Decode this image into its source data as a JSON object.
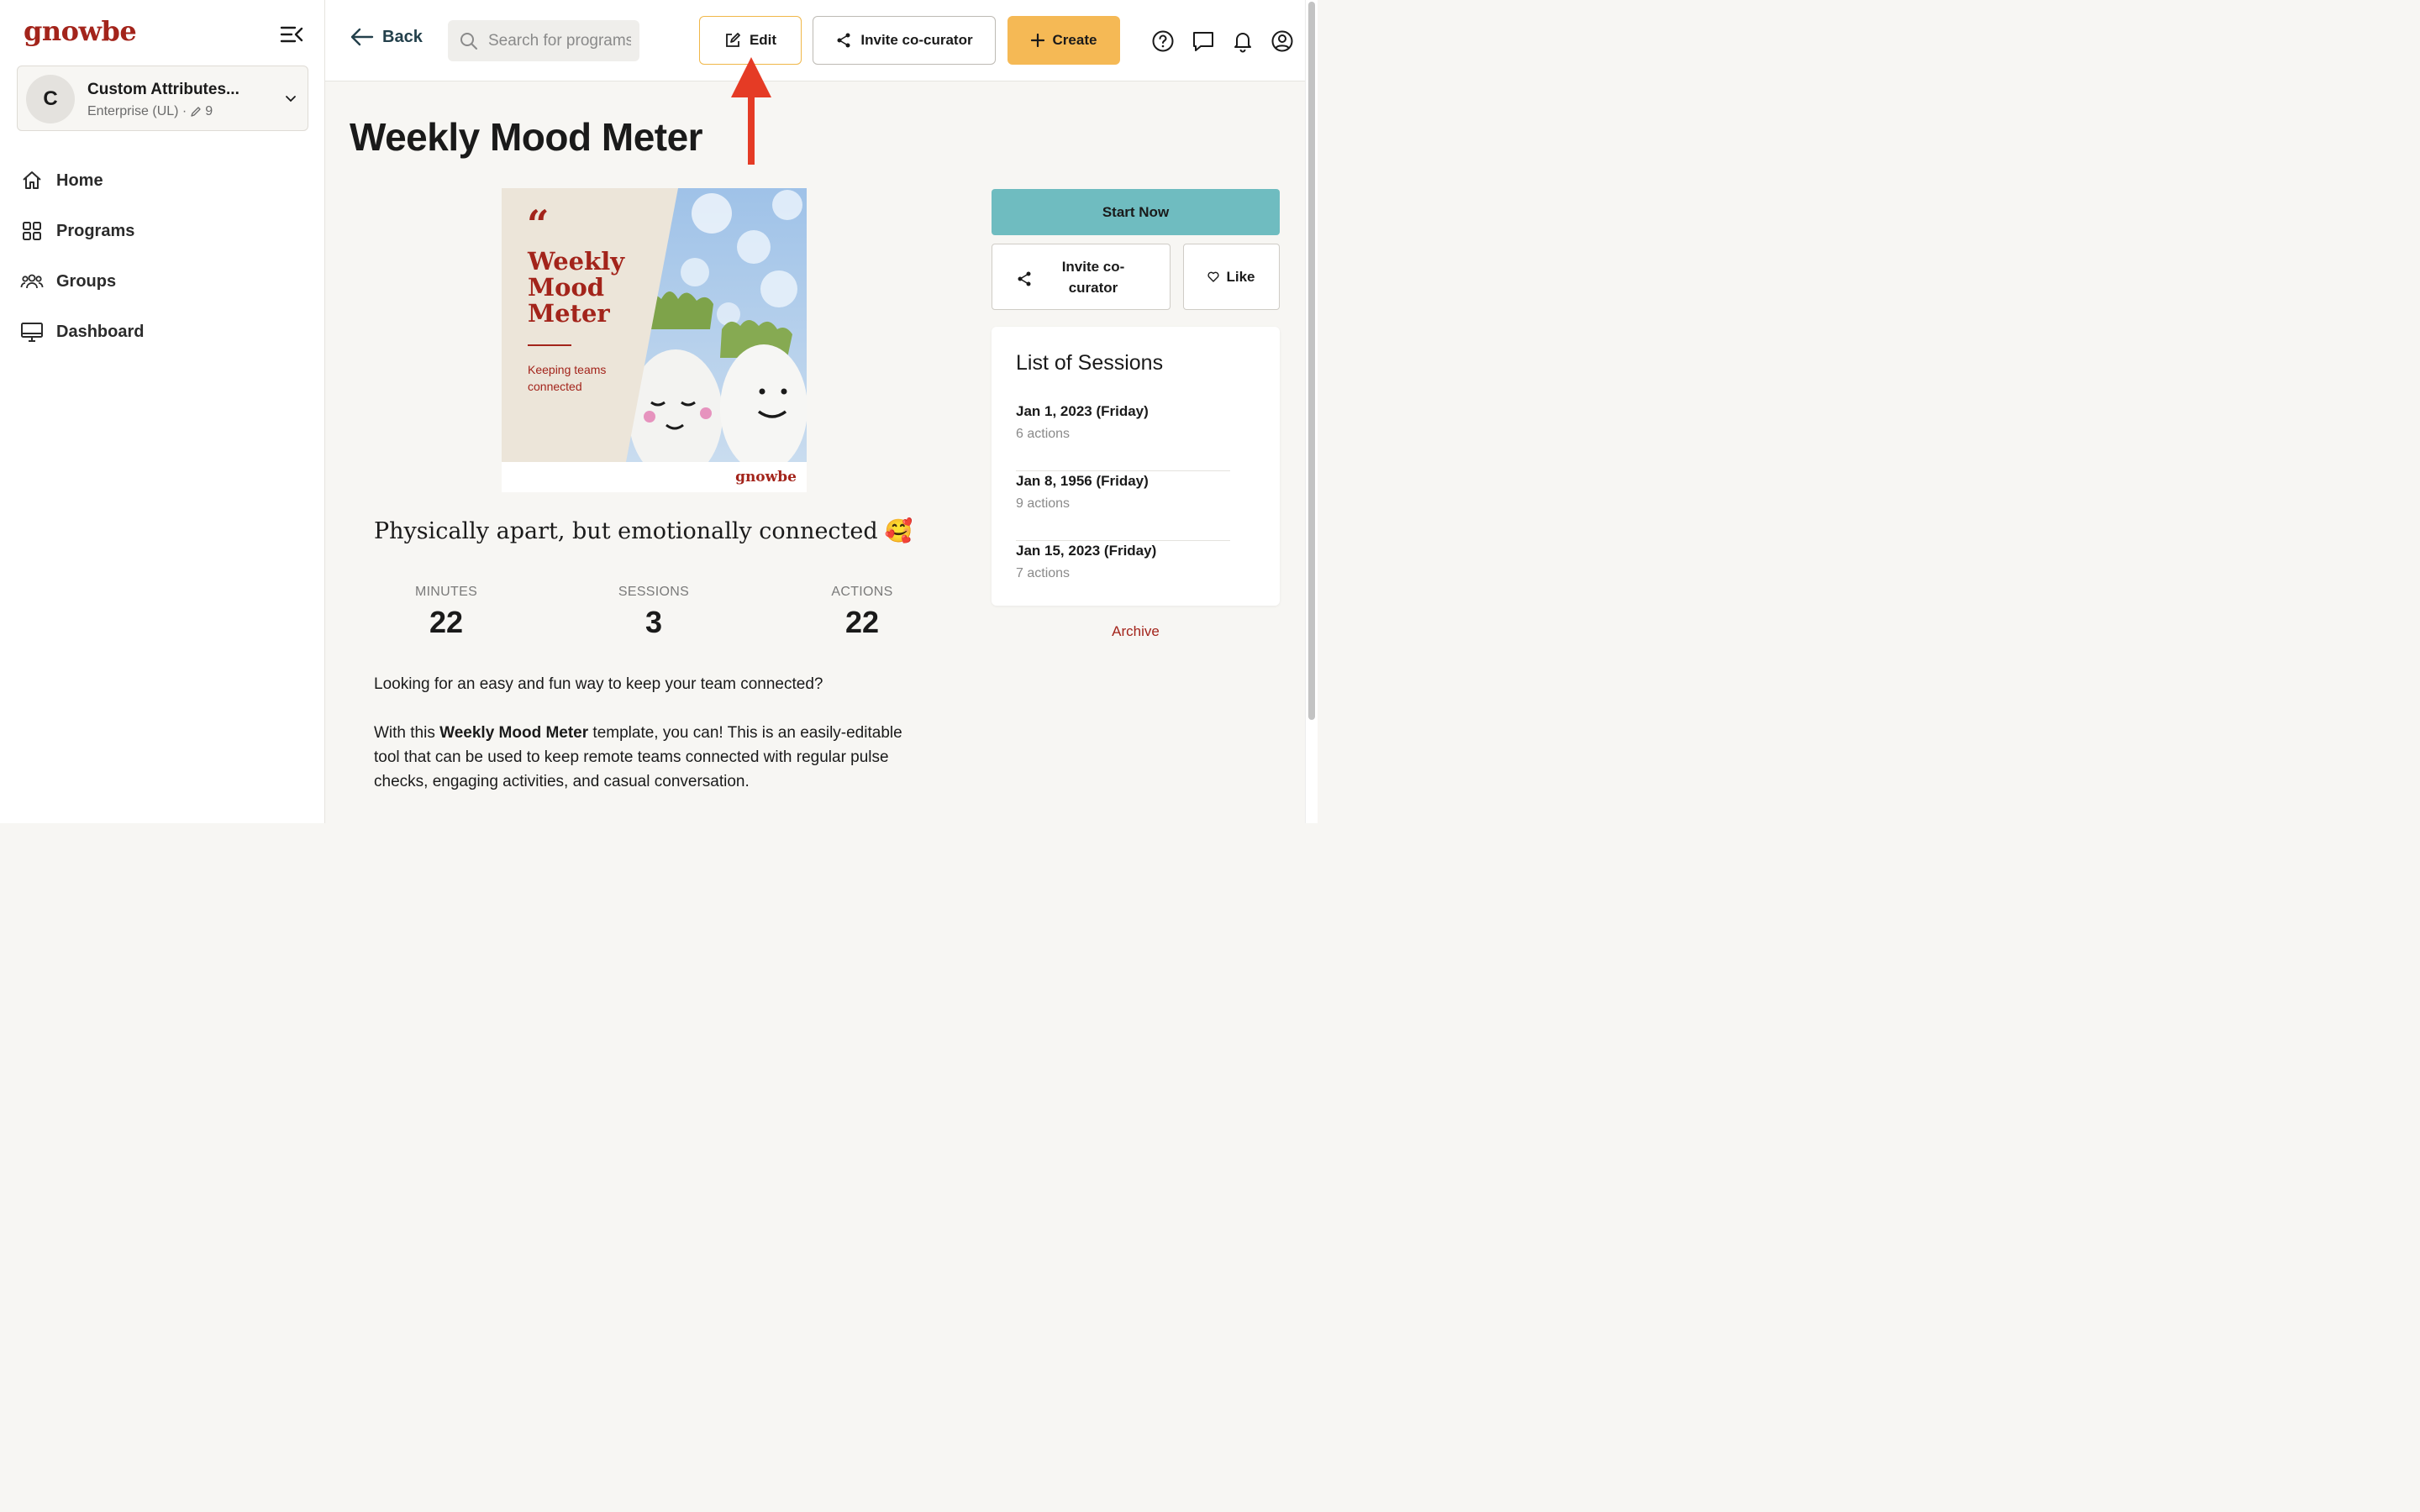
{
  "brand": {
    "logo_text": "gnowbe",
    "accent": "#a3241b",
    "cta_color": "#f5b955",
    "start_color": "#6fbcc0"
  },
  "sidebar": {
    "org": {
      "initial": "C",
      "name": "Custom Attributes...",
      "subtitle": "Enterprise (UL) ·",
      "edit_count": "9"
    },
    "items": [
      {
        "label": "Home",
        "icon": "home-icon"
      },
      {
        "label": "Programs",
        "icon": "grid-icon"
      },
      {
        "label": "Groups",
        "icon": "users-icon"
      },
      {
        "label": "Dashboard",
        "icon": "monitor-icon"
      }
    ]
  },
  "header": {
    "back_label": "Back",
    "search_placeholder": "Search for programs",
    "edit_label": "Edit",
    "invite_label": "Invite co-curator",
    "create_label": "Create"
  },
  "program": {
    "title": "Weekly Mood Meter",
    "cover": {
      "quote_mark": "“",
      "title": "Weekly Mood Meter",
      "tagline": "Keeping teams connected",
      "brand": "gnowbe"
    },
    "tagline": "Physically apart, but emotionally connected",
    "tagline_emoji": "🥰",
    "stats": [
      {
        "label": "MINUTES",
        "value": "22"
      },
      {
        "label": "SESSIONS",
        "value": "3"
      },
      {
        "label": "ACTIONS",
        "value": "22"
      }
    ],
    "description_1": "Looking for an easy and fun way to keep your team connected?",
    "description_2_pre": "With this ",
    "description_2_bold": "Weekly Mood Meter",
    "description_2_post": " template, you can! This is an easily-editable tool that can be used to keep remote teams connected with regular pulse checks, engaging activities, and casual conversation."
  },
  "side_panel": {
    "start_label": "Start Now",
    "invite_label": "Invite co-curator",
    "like_label": "Like",
    "sessions_title": "List of Sessions",
    "sessions": [
      {
        "date": "Jan 1, 2023 (Friday)",
        "actions": "6 actions"
      },
      {
        "date": "Jan 8, 1956 (Friday)",
        "actions": "9 actions"
      },
      {
        "date": "Jan 15, 2023 (Friday)",
        "actions": "7 actions"
      }
    ],
    "archive_label": "Archive"
  }
}
